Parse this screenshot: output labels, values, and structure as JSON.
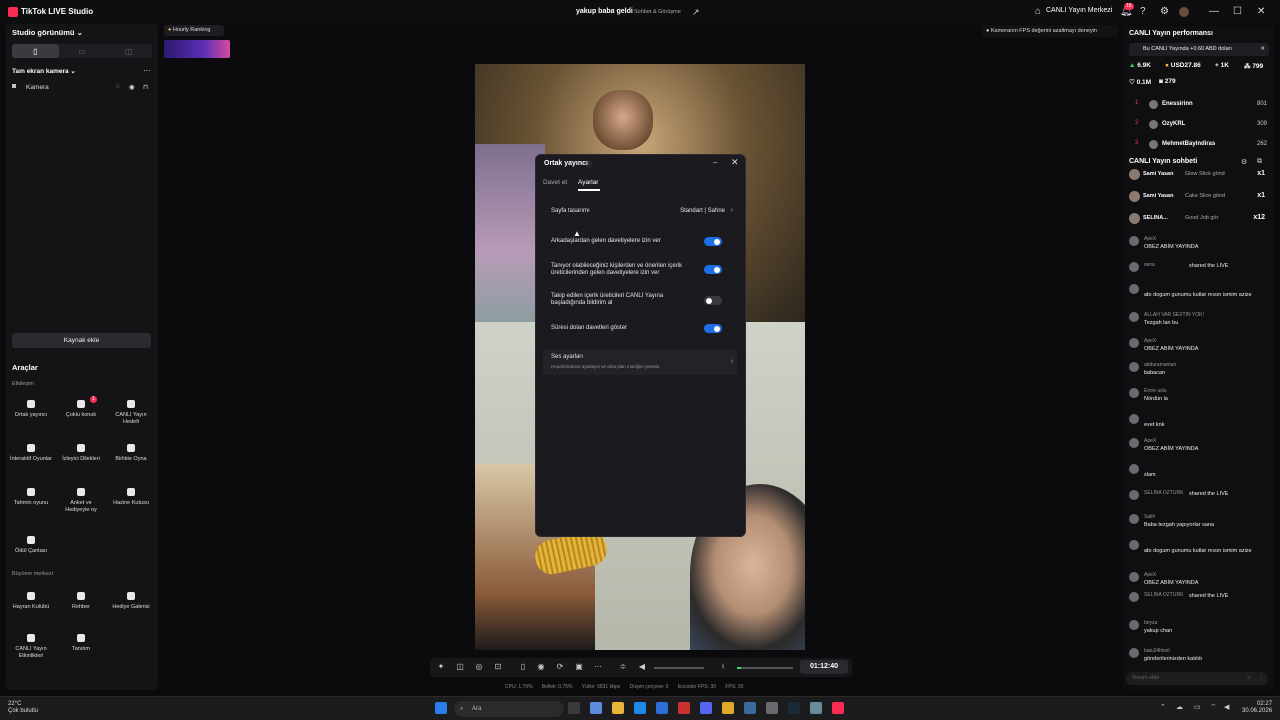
{
  "titlebar": {
    "app_name": "TikTok LIVE Studio",
    "stream_title": "yakup baba geldi",
    "stream_category": "Sohbet & Görüşme",
    "live_center": "CANLI Yayın Merkezi",
    "notification_count": "16"
  },
  "left": {
    "studio_view": "Studio görünümü",
    "scene_name": "Tam ekran kamera",
    "source_camera": "Kamera",
    "add_source": "Kaynak ekle",
    "tools_heading": "Araçlar",
    "interaction_label": "Etkileşim",
    "tools": [
      {
        "label": "Ortak yayıncı",
        "icon": "link-icon"
      },
      {
        "label": "Çoklu konuk",
        "icon": "users-icon",
        "badge": "1"
      },
      {
        "label": "CANLI Yayın Hedefi",
        "icon": "target-icon"
      },
      {
        "label": "İnteraktif Oyunlar",
        "icon": "gamepad-icon"
      },
      {
        "label": "İzleyici Dilekleri",
        "icon": "gift-icon"
      },
      {
        "label": "Birlikte Oyna",
        "icon": "play-together-icon"
      },
      {
        "label": "Tahmin oyunu",
        "icon": "question-icon"
      },
      {
        "label": "Anket ve Hediyeyle oy",
        "icon": "poll-icon"
      },
      {
        "label": "Hazine Kutusu",
        "icon": "treasure-icon"
      },
      {
        "label": "Ödül Çantası",
        "icon": "bag-icon"
      }
    ],
    "growth_label": "Büyüme merkezi",
    "growth_tools": [
      {
        "label": "Hayran Kulübü",
        "icon": "heart-icon"
      },
      {
        "label": "Rehber",
        "icon": "book-icon"
      },
      {
        "label": "Hediye Galerisi",
        "icon": "gallery-icon"
      },
      {
        "label": "CANLI Yayın Etkinlikleri",
        "icon": "calendar-icon"
      },
      {
        "label": "Tanıtım",
        "icon": "flame-icon"
      }
    ]
  },
  "hourly_ranking": "Hourly Ranking",
  "fps_notice": "Kameranın FPS değerini azaltmayı deneyin",
  "modal": {
    "title": "Ortak yayıncı",
    "tabs": [
      "Davet et",
      "Ayarlar"
    ],
    "active_tab": "Ayarlar",
    "layout_label": "Sayfa tasarımı",
    "layout_value": "Standart | Sahne",
    "toggles": [
      {
        "label": "Arkadaşlardan gelen davetiyelere izin ver",
        "on": true
      },
      {
        "label": "Tanıyor olabileceğiniz kişilerden ve önerilen içerik üreticilerinden gelen davetiyelere izin ver",
        "on": true
      },
      {
        "label": "Takip edilen içerik üreticileri CANLI Yayına başladığında bildirim al",
        "on": false
      },
      {
        "label": "Süresi dolan davetleri göster",
        "on": true
      }
    ],
    "sound_title": "Ses ayarları",
    "sound_desc": "Hoparlörünüzü ayarlayın ve arka plan müziğini yönetin."
  },
  "controls": {
    "timer": "01:12:40"
  },
  "stats": {
    "cpu": "CPU: 1.79%",
    "memory": "Bellek: 0.75%",
    "upload": "Yükle: 5831 kbps",
    "dropped": "Düşen çerçeve: 0",
    "encoder_fps": "Encoder FPS: 30",
    "fps": "FPS: 30"
  },
  "right": {
    "perf_title": "CANLI Yayın performansı",
    "perf_banner": "Bu CANLI Yayında +0.60 ABD doları",
    "stats": [
      "6.9K",
      "USD27.86",
      "1K",
      "799",
      "0.1M",
      "279"
    ],
    "ranking": [
      {
        "rank": "1",
        "name": "Enessirinn",
        "score": "801"
      },
      {
        "rank": "2",
        "name": "OzyKRL",
        "score": "309"
      },
      {
        "rank": "3",
        "name": "MehmetBayindiras",
        "score": "262"
      }
    ],
    "chat_title": "CANLI Yayın sohbeti",
    "gifts": [
      {
        "user": "Sami Yasan",
        "gift": "Glow Stick gönd",
        "count": "x1"
      },
      {
        "user": "Sami Yasan",
        "gift": "Cake Slice gönd",
        "count": "x1"
      },
      {
        "user": "SELINA...",
        "gift": "Good Job gör",
        "count": "x12"
      }
    ],
    "chat": [
      {
        "user": "ApeX",
        "msg": "OBEZ ABİM YAYINDA"
      },
      {
        "user": "sena",
        "msg": "shared the LIVE"
      },
      {
        "user": "",
        "msg": "abı dogum gunumu kutlar mısın ismim azize"
      },
      {
        "user": "ALLAH VAR SEXTİN YOK!",
        "msg": "Tezgah lan bu"
      },
      {
        "user": "ApeX",
        "msg": "OBEZ ABİM YAYINDA"
      },
      {
        "user": "abduramantan",
        "msg": "babacan"
      },
      {
        "user": "Emre uslu",
        "msg": "Nördün la"
      },
      {
        "user": "",
        "msg": "evet knk"
      },
      {
        "user": "ApeX",
        "msg": "OBEZ ABİM YAYINDA"
      },
      {
        "user": "",
        "msg": "slam"
      },
      {
        "user": "SELINA OZTURK",
        "msg": "shared the LIVE"
      },
      {
        "user": "Salih",
        "msg": "Baba tezgah yapıyorlar sana"
      },
      {
        "user": "",
        "msg": "abı dogum gunumu kutlar mısın ismim azize"
      },
      {
        "user": "ApeX",
        "msg": "OBEZ ABİM YAYINDA"
      },
      {
        "user": "SELINA OZTURK",
        "msg": "shared the LIVE"
      },
      {
        "user": "beyza",
        "msg": "yakup chan"
      },
      {
        "user": "batu34hisel",
        "msg": "gönderilerinizden katıldı"
      }
    ],
    "comment_placeholder": "Yorum ekle"
  },
  "taskbar": {
    "temp": "22°C",
    "weather": "Çok bulutlu",
    "search": "Ara",
    "time": "02:27",
    "date": "30.06.2026"
  }
}
